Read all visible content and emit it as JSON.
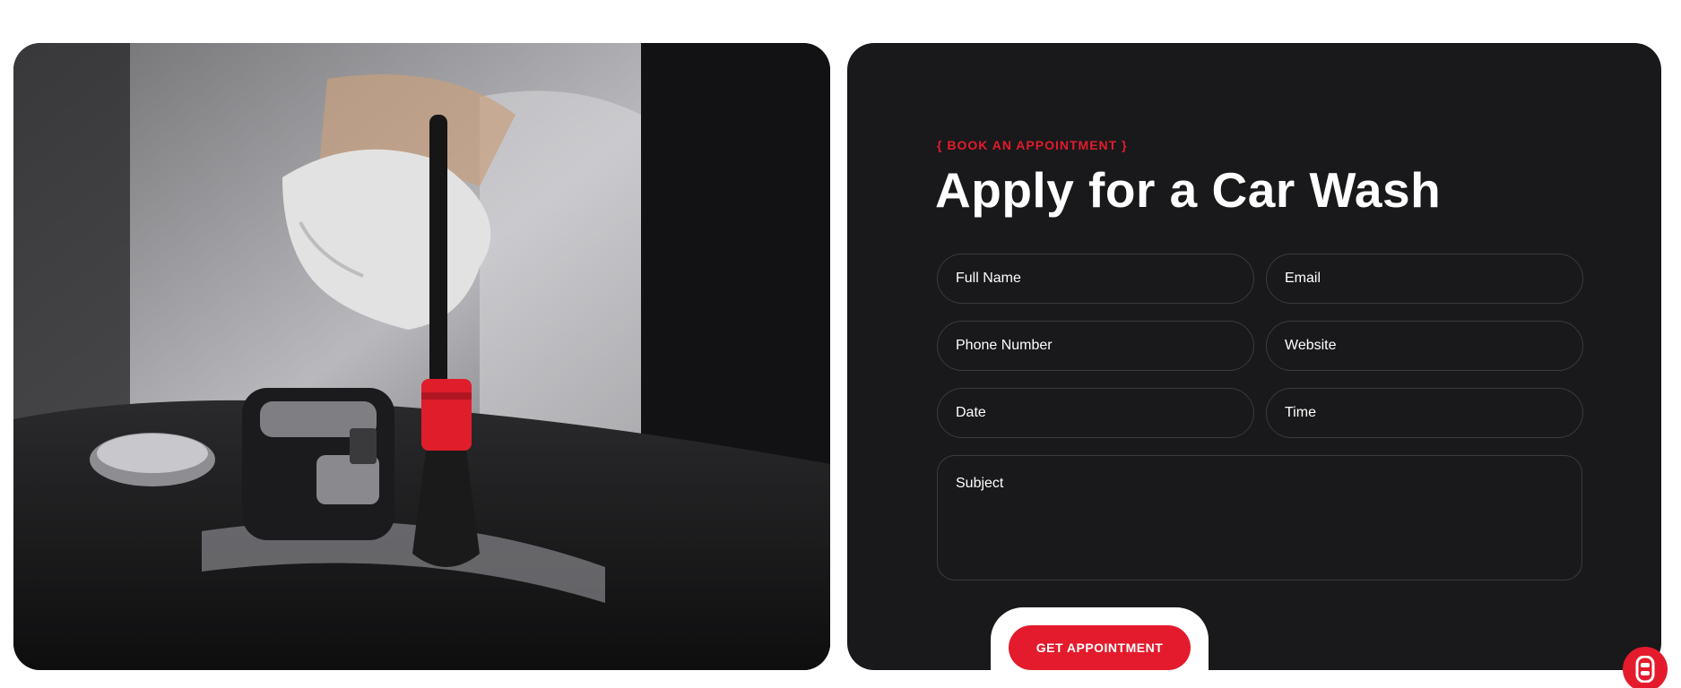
{
  "form": {
    "eyebrow": "{ BOOK AN APPOINTMENT }",
    "title": "Apply for a Car Wash",
    "fields": {
      "full_name": "Full Name",
      "email": "Email",
      "phone": "Phone Number",
      "website": "Website",
      "date": "Date",
      "time": "Time",
      "subject": "Subject"
    },
    "submit_label": "GET APPOINTMENT"
  },
  "image": {
    "icon": "car-interior-brush-photo"
  },
  "floating_button": {
    "icon": "car-icon"
  },
  "colors": {
    "accent": "#e31b2c",
    "panel": "#19191b",
    "field_border": "#3b3b3e"
  }
}
